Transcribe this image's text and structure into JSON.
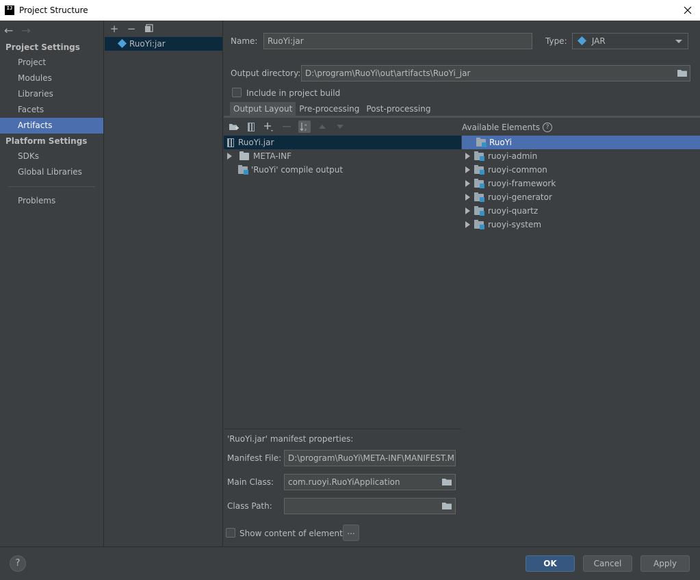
{
  "window": {
    "title": "Project Structure",
    "app_icon": "IJ"
  },
  "nav": {
    "back_icon": "←",
    "forward_icon": "→",
    "sections": [
      {
        "title": "Project Settings",
        "items": [
          "Project",
          "Modules",
          "Libraries",
          "Facets",
          "Artifacts"
        ]
      },
      {
        "title": "Platform Settings",
        "items": [
          "SDKs",
          "Global Libraries"
        ]
      }
    ],
    "selected": "Artifacts",
    "problems": "Problems"
  },
  "artifact_list": {
    "add_icon": "+",
    "remove_icon": "−",
    "items": [
      "RuoYi:jar"
    ]
  },
  "form": {
    "name_label": "Name:",
    "name_value": "RuoYi:jar",
    "type_label": "Type:",
    "type_value": "JAR",
    "output_dir_label": "Output directory:",
    "output_dir_value": "D:\\program\\RuoYi\\out\\artifacts\\RuoYi_jar",
    "include_build_label": "Include in project build"
  },
  "tabs": [
    "Output Layout",
    "Pre-processing",
    "Post-processing"
  ],
  "output_tree": {
    "root": "RuoYi.jar",
    "children": [
      "META-INF",
      "'RuoYi' compile output"
    ]
  },
  "available": {
    "header": "Available Elements",
    "items": [
      "RuoYi",
      "ruoyi-admin",
      "ruoyi-common",
      "ruoyi-framework",
      "ruoyi-generator",
      "ruoyi-quartz",
      "ruoyi-system"
    ]
  },
  "manifest": {
    "title": "'RuoYi.jar' manifest properties:",
    "manifest_file_label": "Manifest File:",
    "manifest_file_value": "D:\\program\\RuoYi\\META-INF\\MANIFEST.MF",
    "main_class_label": "Main Class:",
    "main_class_value": "com.ruoyi.RuoYiApplication",
    "class_path_label": "Class Path:",
    "class_path_value": "",
    "show_content_label": "Show content of elements",
    "ellipsis": "..."
  },
  "buttons": {
    "help": "?",
    "ok": "OK",
    "cancel": "Cancel",
    "apply": "Apply"
  }
}
